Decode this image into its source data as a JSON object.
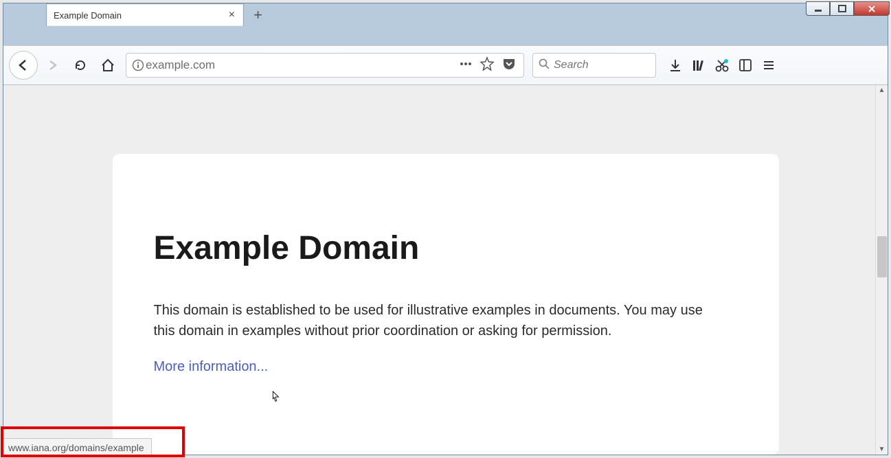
{
  "window": {
    "tab_title": "Example Domain"
  },
  "toolbar": {
    "url": "example.com",
    "search_placeholder": "Search"
  },
  "page": {
    "heading": "Example Domain",
    "paragraph": "This domain is established to be used for illustrative examples in documents. You may use this domain in examples without prior coordination or asking for permission.",
    "link_text": "More information..."
  },
  "status": {
    "link_target": "www.iana.org/domains/example"
  }
}
